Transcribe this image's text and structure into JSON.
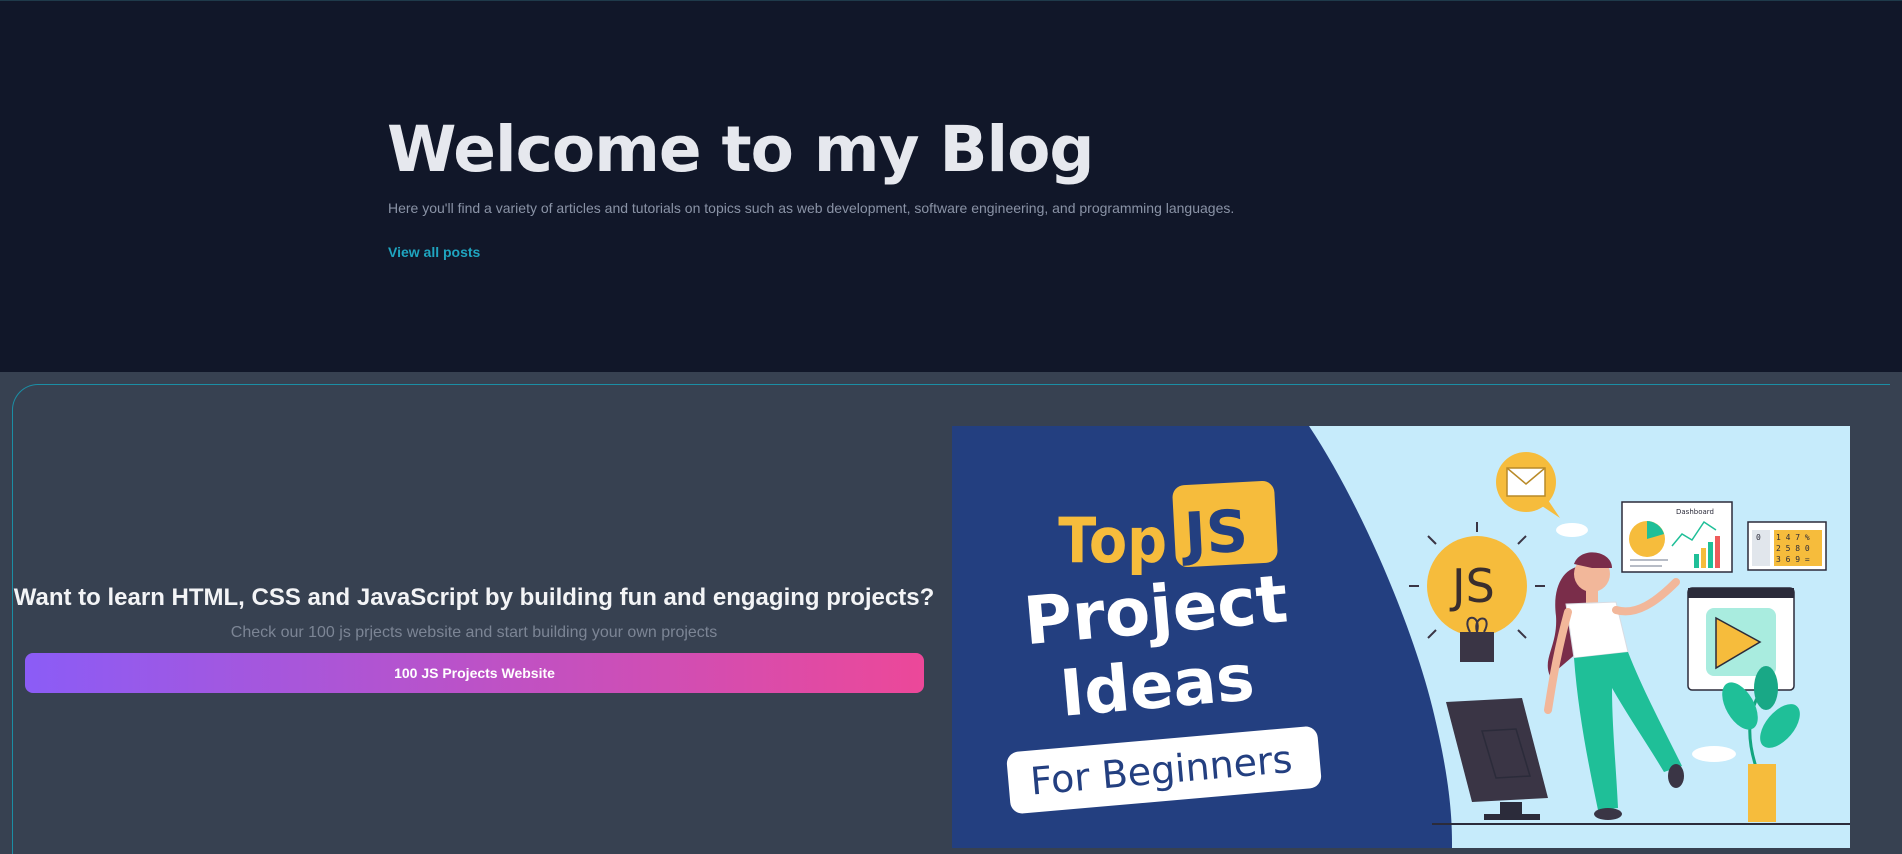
{
  "hero": {
    "title": "Welcome to my Blog",
    "subtitle": "Here you'll find a variety of articles and tutorials on topics such as web development, software engineering, and programming languages.",
    "link_label": "View all posts"
  },
  "promo": {
    "title": "Want to learn HTML, CSS and JavaScript by building fun and engaging projects?",
    "subtitle": "Check our 100 js prjects website and start building your own projects",
    "button_label": "100 JS Projects Website"
  },
  "banner": {
    "top": "Top",
    "js": "JS",
    "line1": "Project",
    "line2": "Ideas",
    "pill": "For Beginners",
    "bulb_text": "JS",
    "dashboard_label": "Dashboard",
    "calc_rows": [
      "1 4 7 %",
      "2 5 8 0",
      "3 6 9 ="
    ],
    "calc_zero": "0"
  },
  "colors": {
    "hero_bg": "#111729",
    "lower_bg": "#374151",
    "accent_link": "#1fa5c0",
    "button_gradient_start": "#8b5cf6",
    "button_gradient_end": "#ec4899",
    "banner_navy": "#233f80",
    "banner_sky": "#c6ebfb",
    "banner_yellow": "#f6bc3c",
    "banner_green": "#1fbf98"
  }
}
